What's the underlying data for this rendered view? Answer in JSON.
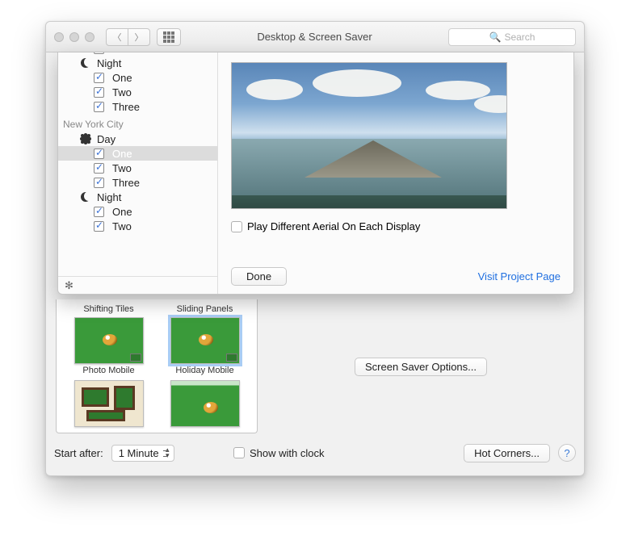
{
  "window": {
    "title": "Desktop & Screen Saver",
    "search_placeholder": "Search"
  },
  "sheet": {
    "groups": [
      {
        "name_partial": "",
        "night_label": "Night",
        "night_items": [
          {
            "label": "One",
            "checked": true
          },
          {
            "label": "Two",
            "checked": true
          },
          {
            "label": "Three",
            "checked": true
          }
        ]
      },
      {
        "name": "New York City",
        "day_label": "Day",
        "day_items": [
          {
            "label": "One",
            "checked": true,
            "selected": true
          },
          {
            "label": "Two",
            "checked": true
          },
          {
            "label": "Three",
            "checked": true
          }
        ],
        "night_label": "Night",
        "night_items": [
          {
            "label": "One",
            "checked": true
          },
          {
            "label": "Two",
            "checked": true
          }
        ]
      }
    ],
    "diff_checkbox": "Play Different Aerial On Each Display",
    "done_button": "Done",
    "link": "Visit Project Page"
  },
  "savers": {
    "row1": [
      {
        "label": "Shifting Tiles"
      },
      {
        "label": "Sliding Panels"
      }
    ],
    "row2": [
      {
        "label": "Photo Mobile"
      },
      {
        "label": "Holiday Mobile",
        "selected": true
      }
    ]
  },
  "options_button": "Screen Saver Options...",
  "bottom": {
    "start_after_label": "Start after:",
    "start_after_value": "1 Minute",
    "show_clock": "Show with clock",
    "hot_corners": "Hot Corners..."
  }
}
